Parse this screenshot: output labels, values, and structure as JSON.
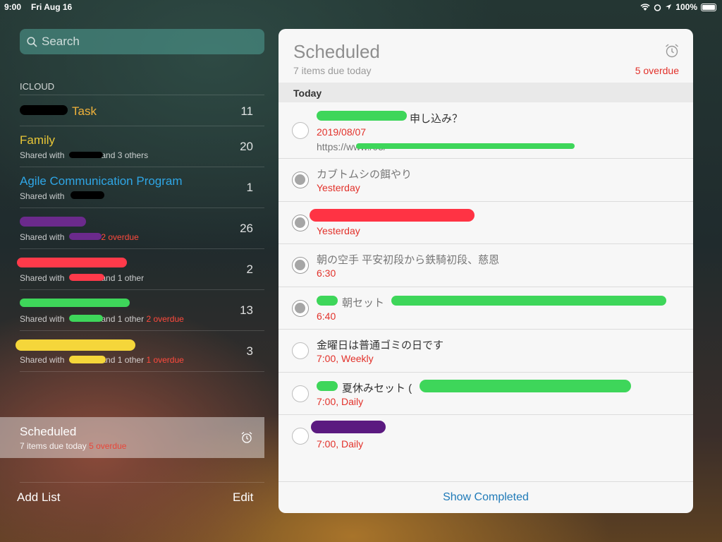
{
  "status": {
    "time": "9:00",
    "date": "Fri Aug 16",
    "battery": "100%"
  },
  "search": {
    "placeholder": "Search"
  },
  "sidebar": {
    "section": "ICLOUD",
    "lists": [
      {
        "name": "Task",
        "sub": "",
        "overdue": "",
        "count": "11",
        "color": "#f0b23a"
      },
      {
        "name": "Family",
        "sub": "Shared with",
        "sub2": "and 3 others",
        "overdue": "",
        "count": "20",
        "color": "#e8c637"
      },
      {
        "name": "Agile Communication Program",
        "sub": "Shared with",
        "sub2": "",
        "overdue": "",
        "count": "1",
        "color": "#2fa6e6"
      },
      {
        "name": "",
        "sub": "Shared with",
        "sub2": "",
        "overdue": "2 overdue",
        "count": "26",
        "color": "#fff"
      },
      {
        "name": "",
        "sub": "Shared with",
        "sub2": "and 1 other",
        "overdue": "",
        "count": "2",
        "color": "#fff"
      },
      {
        "name": "",
        "sub": "Shared with",
        "sub2": "and 1 other",
        "overdue": "2 overdue",
        "count": "13",
        "color": "#fff"
      },
      {
        "name": "",
        "sub": "Shared with",
        "sub2": "and 1 other",
        "overdue": "1 overdue",
        "count": "3",
        "color": "#fff"
      }
    ],
    "scheduled": {
      "title": "Scheduled",
      "due": "7 items due today",
      "overdue": "5 overdue"
    },
    "add_list": "Add List",
    "edit": "Edit"
  },
  "panel": {
    "title": "Scheduled",
    "due": "7 items due today",
    "overdue": "5 overdue",
    "section": "Today",
    "items": [
      {
        "text": "申し込み？",
        "date": "2019/08/07",
        "url": "https://www./03/",
        "done": false
      },
      {
        "text": "カブトムシの餌やり",
        "date": "Yesterday",
        "done": true
      },
      {
        "text": "",
        "date": "Yesterday",
        "done": true
      },
      {
        "text": "朝の空手 平安初段から鉄騎初段、慈恩",
        "date": "6:30",
        "done": true
      },
      {
        "text": "朝セット",
        "date": "6:40",
        "done": true
      },
      {
        "text": "金曜日は普通ゴミの日です",
        "date": "7:00, Weekly",
        "done": false
      },
      {
        "text": "夏休みセット (",
        "date": "7:00, Daily",
        "done": false
      },
      {
        "text": "",
        "date": "7:00, Daily",
        "done": false
      }
    ],
    "show_completed": "Show Completed"
  },
  "colors": {
    "overdue": "#e2312a",
    "link": "#1f7ab8"
  }
}
